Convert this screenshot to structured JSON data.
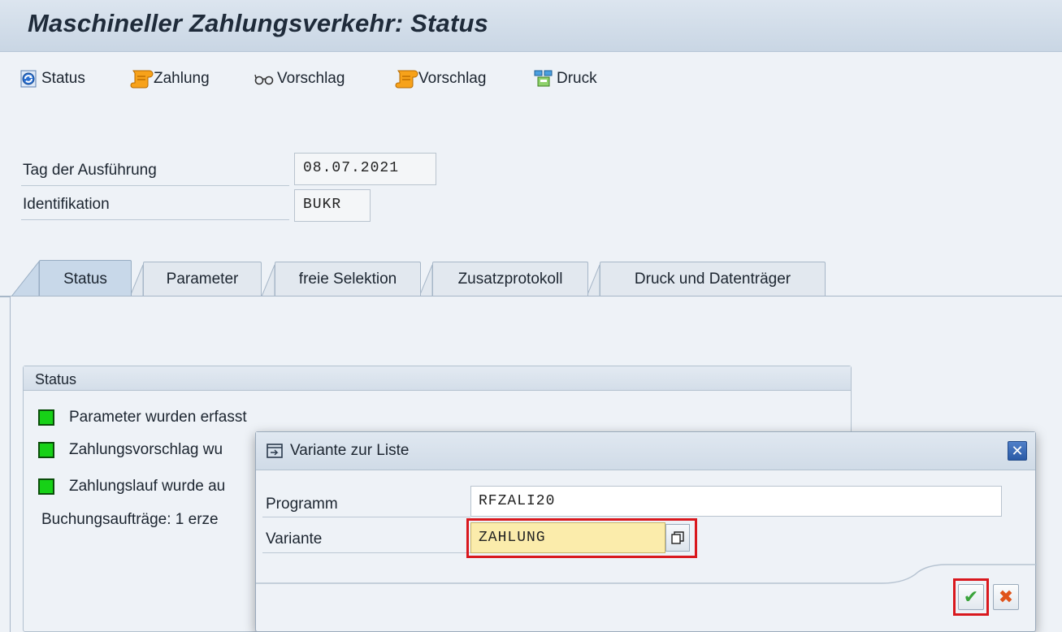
{
  "window": {
    "title": "Maschineller Zahlungsverkehr: Status"
  },
  "toolbar": {
    "items": [
      {
        "label": "Status",
        "icon": "refresh-status-icon"
      },
      {
        "label": "Zahlung",
        "icon": "payment-scroll-icon"
      },
      {
        "label": "Vorschlag",
        "icon": "glasses-proposal-icon"
      },
      {
        "label": "Vorschlag",
        "icon": "proposal-scroll-icon"
      },
      {
        "label": "Druck",
        "icon": "print-icon"
      }
    ]
  },
  "header": {
    "run_date_label": "Tag der Ausführung",
    "run_date_value": "08.07.2021",
    "identification_label": "Identifikation",
    "identification_value": "BUKR"
  },
  "tabs": [
    {
      "label": "Status",
      "active": true
    },
    {
      "label": "Parameter",
      "active": false
    },
    {
      "label": "freie Selektion",
      "active": false
    },
    {
      "label": "Zusatzprotokoll",
      "active": false
    },
    {
      "label": "Druck und Datenträger",
      "active": false
    }
  ],
  "status_group": {
    "title": "Status",
    "rows": [
      {
        "text": "Parameter wurden erfasst",
        "status_color": "#17d117"
      },
      {
        "text": "Zahlungsvorschlag wu",
        "status_color": "#17d117"
      },
      {
        "text": "Zahlungslauf wurde au",
        "status_color": "#17d117"
      }
    ],
    "summary": "Buchungsaufträge: 1 erze"
  },
  "dialog": {
    "title": "Variante zur Liste",
    "program_label": "Programm",
    "program_value": "RFZALI20",
    "variant_label": "Variante",
    "variant_value": "ZAHLUNG",
    "confirm_icon": "check-icon",
    "cancel_icon": "close-icon"
  },
  "colors": {
    "highlight": "#d9181e",
    "required_field": "#fbecab",
    "status_green": "#17d117",
    "dialog_close": "#2a5aa6"
  }
}
